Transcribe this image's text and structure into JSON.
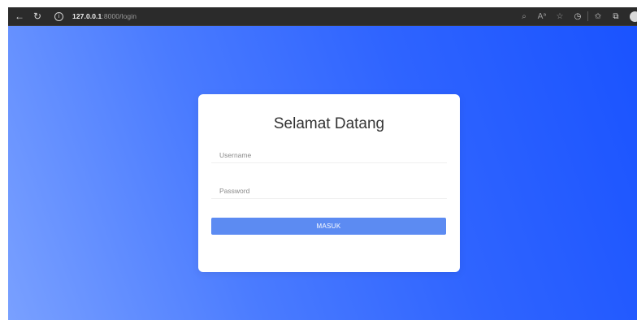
{
  "browser": {
    "url_host": "127.0.0.1",
    "url_path": ":8000/login",
    "back_icon": "←",
    "reload_icon": "↻",
    "info_icon": "i",
    "tools": [
      "⌕",
      "Aᵃ",
      "☆",
      "◷",
      "✩",
      "⧉"
    ]
  },
  "login": {
    "title": "Selamat Datang",
    "username_placeholder": "Username",
    "password_placeholder": "Password",
    "submit_label": "MASUK"
  },
  "colors": {
    "background_gradient_start": "#79a0ff",
    "background_gradient_end": "#1a53ff",
    "button": "#5c8bf2",
    "card": "#ffffff"
  }
}
